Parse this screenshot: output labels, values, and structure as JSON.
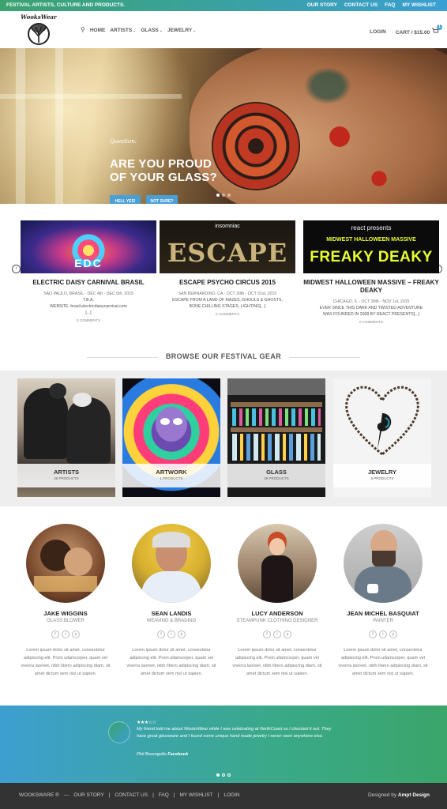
{
  "topbar": {
    "tagline": "FESTIVAL ARTISTS, CULTURE AND PRODUCTS.",
    "links": [
      "OUR STORY",
      "CONTACT US",
      "FAQ",
      "MY WISHLIST"
    ]
  },
  "header": {
    "logo_text": "WooksWear",
    "nav": [
      {
        "label": "HOME",
        "caret": ""
      },
      {
        "label": "ARTISTS",
        "caret": "⌄"
      },
      {
        "label": "GLASS",
        "caret": "⌄"
      },
      {
        "label": "JEWELRY",
        "caret": "⌄"
      }
    ],
    "login": "LOGIN",
    "cart": "CART / $15.00",
    "cart_count": "1"
  },
  "hero": {
    "question": "Question:",
    "headline_line1": "ARE YOU PROUD",
    "headline_line2": "OF YOUR GLASS?",
    "btn_yes": "HELL YES!",
    "btn_no": "NOT SURE?"
  },
  "events": [
    {
      "img_text": "EDC",
      "title": "ELECTRIC DAISY CARNIVAL BRASIL",
      "meta": "SAO PAULO, BRASIL - DEC 4th - DEC 5th, 2015",
      "desc1": "T.B.A.",
      "desc2": "WEBSITE: brasil.electricdaisycarnival.com",
      "desc3": "[...]",
      "comments": "0 COMMENTS"
    },
    {
      "img_brand": "insomniac",
      "img_text": "ESCAPE",
      "title": "ESCAPE PSYCHO CIRCUS 2015",
      "meta": "SAN BERNARDINO, CA - OCT 30th - OCT 31st, 2015",
      "desc1": "ESCAPE FROM A LAND OF MAZES, GHOULS & GHOSTS,",
      "desc2": "BONE CHILLING STAGES, LIGHTING[...]",
      "desc3": "",
      "comments": "0 COMMENTS"
    },
    {
      "img_brand": "react presents",
      "img_sub": "MIDWEST HALLOWEEN MASSIVE",
      "img_text": "FREAKY DEAKY",
      "title": "MIDWEST HALLOWEEN MASSIVE – FREAKY DEAKY",
      "meta": "CHICAGO, IL - OCT 30th - NOV 1st, 2015",
      "desc1": "EVER SINCE THIS DARK AND TWISTED ADVENTURE",
      "desc2": "WAS FOUNDED IN 2008 BY REACT PRESENTS[...]",
      "desc3": "",
      "comments": "0 COMMENTS"
    }
  ],
  "browse": {
    "heading": "BROWSE OUR FESTIVAL GEAR",
    "categories": [
      {
        "name": "ARTISTS",
        "count": "46 PRODUCTS"
      },
      {
        "name": "ARTWORK",
        "count": "1 PRODUCTS"
      },
      {
        "name": "GLASS",
        "count": "48 PRODUCTS"
      },
      {
        "name": "JEWELRY",
        "count": "5 PRODUCTS"
      }
    ]
  },
  "team": [
    {
      "name": "JAKE WIGGINS",
      "role": "GLASS BLOWER"
    },
    {
      "name": "SEAN LANDIS",
      "role": "WEAVING & BRADING"
    },
    {
      "name": "LUCY ANDERSON",
      "role": "STEAMPUNK CLOTHING DESIGNER"
    },
    {
      "name": "JEAN MICHEL BASQUIAT",
      "role": "PAINTER"
    }
  ],
  "team_bio": "Lorem ipsum dolor sit amet, consectetur adipiscing elit. Proin ullamcorper, quam vel viverra laoreet, nibh libero adipiscing diam, sit amet dictum sem nisi ut sapien.",
  "social_icons": [
    "f",
    "t",
    "p"
  ],
  "testimonial": {
    "stars": "★★★☆☆",
    "quote": "My friend told me about WooksWear while I was celebrating at NorthCoast so I checked it out. They have great glassware and I found some unique hand made jewelry I never seen anywhere else.",
    "author": "Phil Barengolts",
    "source": "Facebook"
  },
  "footer": {
    "links": [
      "WOOKSWARE ®",
      "—",
      "OUR STORY",
      "|",
      "CONTACT US",
      "|",
      "FAQ",
      "|",
      "MY WISHLIST",
      "|",
      "LOGIN"
    ],
    "credit_prefix": "Designed by",
    "credit_name": "Ampt Design"
  }
}
